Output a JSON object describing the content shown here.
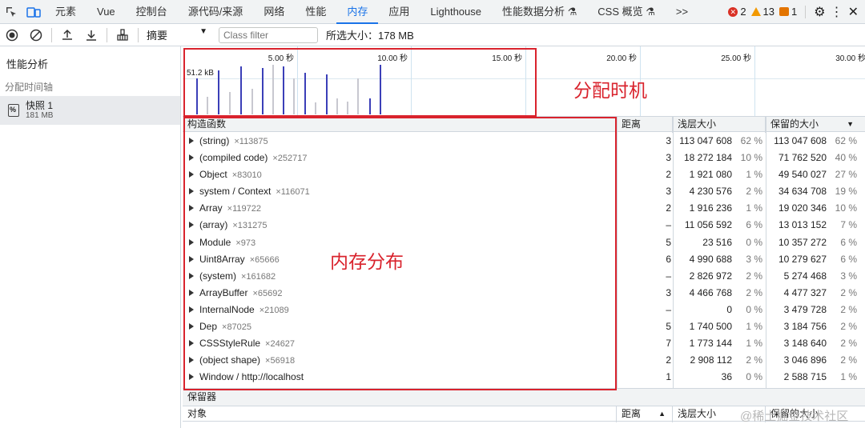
{
  "tabs": [
    "元素",
    "Vue",
    "控制台",
    "源代码/来源",
    "网络",
    "性能",
    "内存",
    "应用",
    "Lighthouse",
    "性能数据分析 ⚗",
    "CSS 概览 ⚗"
  ],
  "active_tab": "内存",
  "more_tabs": ">>",
  "status": {
    "errors": "2",
    "warnings": "13",
    "issues": "1"
  },
  "toolbar": {
    "view_select": "摘要",
    "class_filter_placeholder": "Class filter",
    "selected_size": "所选大小：178 MB"
  },
  "sidebar": {
    "title": "性能分析",
    "group": "分配时间轴",
    "snapshot_name": "快照 1",
    "snapshot_size": "181 MB"
  },
  "timeline": {
    "ticks": [
      "5.00 秒",
      "10.00 秒",
      "15.00 秒",
      "20.00 秒",
      "25.00 秒",
      "30.00 秒"
    ],
    "memory_label": "51.2 kB"
  },
  "annotations": {
    "timing": "分配时机",
    "distribution": "内存分布"
  },
  "table": {
    "headers": {
      "constructor": "构造函数",
      "distance": "距离",
      "shallow": "浅层大小",
      "retained": "保留的大小"
    },
    "rows": [
      {
        "name": "(string)",
        "count": "×113875",
        "distance": "3",
        "shallow": "113 047 608",
        "shallow_pct": "62 %",
        "retained": "113 047 608",
        "retained_pct": "62 %"
      },
      {
        "name": "(compiled code)",
        "count": "×252717",
        "distance": "3",
        "shallow": "18 272 184",
        "shallow_pct": "10 %",
        "retained": "71 762 520",
        "retained_pct": "40 %"
      },
      {
        "name": "Object",
        "count": "×83010",
        "distance": "2",
        "shallow": "1 921 080",
        "shallow_pct": "1 %",
        "retained": "49 540 027",
        "retained_pct": "27 %"
      },
      {
        "name": "system / Context",
        "count": "×116071",
        "distance": "3",
        "shallow": "4 230 576",
        "shallow_pct": "2 %",
        "retained": "34 634 708",
        "retained_pct": "19 %"
      },
      {
        "name": "Array",
        "count": "×119722",
        "distance": "2",
        "shallow": "1 916 236",
        "shallow_pct": "1 %",
        "retained": "19 020 346",
        "retained_pct": "10 %"
      },
      {
        "name": "(array)",
        "count": "×131275",
        "distance": "–",
        "shallow": "11 056 592",
        "shallow_pct": "6 %",
        "retained": "13 013 152",
        "retained_pct": "7 %"
      },
      {
        "name": "Module",
        "count": "×973",
        "distance": "5",
        "shallow": "23 516",
        "shallow_pct": "0 %",
        "retained": "10 357 272",
        "retained_pct": "6 %"
      },
      {
        "name": "Uint8Array",
        "count": "×65666",
        "distance": "6",
        "shallow": "4 990 688",
        "shallow_pct": "3 %",
        "retained": "10 279 627",
        "retained_pct": "6 %"
      },
      {
        "name": "(system)",
        "count": "×161682",
        "distance": "–",
        "shallow": "2 826 972",
        "shallow_pct": "2 %",
        "retained": "5 274 468",
        "retained_pct": "3 %"
      },
      {
        "name": "ArrayBuffer",
        "count": "×65692",
        "distance": "3",
        "shallow": "4 466 768",
        "shallow_pct": "2 %",
        "retained": "4 477 327",
        "retained_pct": "2 %"
      },
      {
        "name": "InternalNode",
        "count": "×21089",
        "distance": "–",
        "shallow": "0",
        "shallow_pct": "0 %",
        "retained": "3 479 728",
        "retained_pct": "2 %"
      },
      {
        "name": "Dep",
        "count": "×87025",
        "distance": "5",
        "shallow": "1 740 500",
        "shallow_pct": "1 %",
        "retained": "3 184 756",
        "retained_pct": "2 %"
      },
      {
        "name": "CSSStyleRule",
        "count": "×24627",
        "distance": "7",
        "shallow": "1 773 144",
        "shallow_pct": "1 %",
        "retained": "3 148 640",
        "retained_pct": "2 %"
      },
      {
        "name": "(object shape)",
        "count": "×56918",
        "distance": "2",
        "shallow": "2 908 112",
        "shallow_pct": "2 %",
        "retained": "3 046 896",
        "retained_pct": "2 %"
      },
      {
        "name": "Window / http://localhost",
        "count": "",
        "distance": "1",
        "shallow": "36",
        "shallow_pct": "0 %",
        "retained": "2 588 715",
        "retained_pct": "1 %"
      }
    ]
  },
  "retainers": {
    "title": "保留器",
    "headers": {
      "object": "对象",
      "distance": "距离",
      "shallow": "浅层大小",
      "retained": "保留的大小"
    }
  },
  "watermark": "@稀土掘金技术社区",
  "colors": {
    "accent": "#1a73e8",
    "annotation": "#d9232d",
    "bar_active": "#3b3fb8",
    "bar_inactive": "#c8c8d0"
  }
}
